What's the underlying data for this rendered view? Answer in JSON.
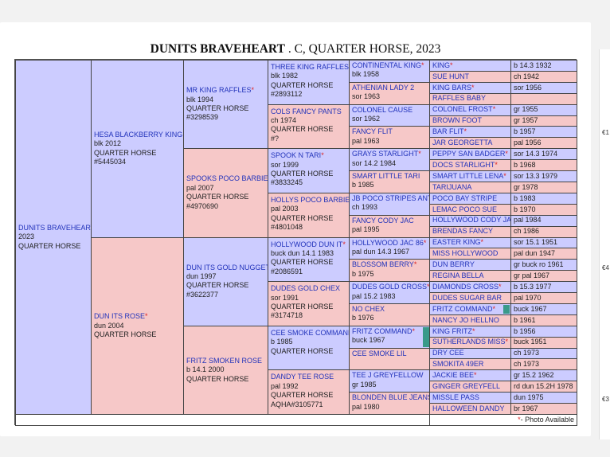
{
  "title": {
    "name": "DUNITS BRAVEHEART",
    "rest": " . C, QUARTER HORSE, 2023"
  },
  "colors": {
    "male": "#ccccff",
    "female": "#f6c8c8",
    "star": "#dd2222",
    "name": "#2233bb"
  },
  "subject": {
    "name": "DUNITS BRAVEHEART",
    "l1": "2023",
    "l2": "QUARTER HORSE"
  },
  "gen1": {
    "sire": {
      "name": "HESA BLACKBERRY KING",
      "l1": "blk 2012",
      "l2": "QUARTER HORSE",
      "l3": "#5445034"
    },
    "dam": {
      "name": "DUN ITS ROSE",
      "l1": "dun 2004",
      "l2": "QUARTER HORSE"
    }
  },
  "gen2": [
    {
      "name": "MR KING RAFFLES",
      "l1": "blk 1994",
      "l2": "QUARTER HORSE",
      "l3": "#3298539"
    },
    {
      "name": "SPOOKS POCO BARBIE",
      "l1": "pal 2007",
      "l2": "QUARTER HORSE",
      "l3": "#4970690"
    },
    {
      "name": "DUN ITS GOLD NUGGET",
      "l1": "dun 1997",
      "l2": "QUARTER HORSE",
      "l3": "#3622377"
    },
    {
      "name": "FRITZ SMOKEN ROSE",
      "l1": "b 14.1 2000",
      "l2": "QUARTER HORSE"
    }
  ],
  "gen3": [
    {
      "name": "THREE KING RAFFLES",
      "l1": "blk 1982",
      "l2": "QUARTER HORSE",
      "l3": "#2893112"
    },
    {
      "name": "COLS FANCY PANTS",
      "l1": "ch 1974",
      "l2": "QUARTER HORSE",
      "l3": "#?"
    },
    {
      "name": "SPOOK N TARI",
      "l1": "sor 1999",
      "l2": "QUARTER HORSE",
      "l3": "#3833245"
    },
    {
      "name": "HOLLYS POCO BARBIE",
      "l1": "pal 2003",
      "l2": "QUARTER HORSE",
      "l3": "#4801048"
    },
    {
      "name": "HOLLYWOOD DUN IT",
      "l1": "buck dun 14.1 1983",
      "l2": "QUARTER HORSE",
      "l3": "#2086591"
    },
    {
      "name": "DUDES GOLD CHEX",
      "l1": "sor 1991",
      "l2": "QUARTER HORSE",
      "l3": "#3174718"
    },
    {
      "name": "CEE SMOKE COMMAND",
      "l1": "b 1985",
      "l2": "QUARTER HORSE"
    },
    {
      "name": "DANDY TEE ROSE",
      "l1": "pal 1992",
      "l2": "QUARTER HORSE",
      "l3": "AQHA#3105771"
    }
  ],
  "gen4": [
    {
      "name": "CONTINENTAL KING",
      "l1": "blk 1958"
    },
    {
      "name": "ATHENIAN LADY 2",
      "l1": "sor 1963"
    },
    {
      "name": "COLONEL CAUSE",
      "l1": "sor 1962"
    },
    {
      "name": "FANCY FLIT",
      "l1": "pal 1963"
    },
    {
      "name": "GRAYS STARLIGHT",
      "l1": "sor 14.2 1984"
    },
    {
      "name": "SMART LITTLE TARI",
      "l1": "b 1985"
    },
    {
      "name": "JB POCO STRIPES ANT",
      "l1": "ch 1993"
    },
    {
      "name": "FANCY CODY JAC",
      "l1": "pal 1995"
    },
    {
      "name": "HOLLYWOOD JAC 86",
      "l1": "pal dun 14.3 1967"
    },
    {
      "name": "BLOSSOM BERRY",
      "l1": "b 1975"
    },
    {
      "name": "DUDES GOLD CROSS",
      "l1": "pal 15.2 1983"
    },
    {
      "name": "NO CHEX",
      "l1": "b 1976"
    },
    {
      "name": "FRITZ COMMAND",
      "l1": "buck 1967"
    },
    {
      "name": "CEE SMOKE LIL",
      "l1": ""
    },
    {
      "name": "TEE J GREYFELLOW",
      "l1": "gr 1985"
    },
    {
      "name": "BLONDEN BLUE JEANS",
      "l1": "pal 1980"
    }
  ],
  "gen5": [
    {
      "name": "KING",
      "info": "b 14.3 1932"
    },
    {
      "name": "SUE HUNT",
      "info": "ch 1942"
    },
    {
      "name": "KING BARS",
      "info": "sor 1956"
    },
    {
      "name": "RAFFLES BABY",
      "info": ""
    },
    {
      "name": "COLONEL FROST",
      "info": "gr 1955"
    },
    {
      "name": "BROWN FOOT",
      "info": "gr 1957"
    },
    {
      "name": "BAR FLIT",
      "info": "b 1957"
    },
    {
      "name": "JAR GEORGETTA",
      "info": "pal 1956"
    },
    {
      "name": "PEPPY SAN BADGER",
      "info": "sor 14.3 1974"
    },
    {
      "name": "DOCS STARLIGHT",
      "info": "b 1968"
    },
    {
      "name": "SMART LITTLE LENA",
      "info": "sor 13.3 1979"
    },
    {
      "name": "TARIJUANA",
      "info": "gr 1978"
    },
    {
      "name": "POCO BAY STRIPE",
      "info": "b 1983"
    },
    {
      "name": "LEMAC POCO SUE",
      "info": "b 1970"
    },
    {
      "name": "HOLLYWOOD CODY JAC",
      "info": "pal 1984"
    },
    {
      "name": "BRENDAS FANCY",
      "info": "ch 1986"
    },
    {
      "name": "EASTER KING",
      "info": "sor 15.1 1951"
    },
    {
      "name": "MISS HOLLYWOOD",
      "info": "pal dun 1947"
    },
    {
      "name": "DUN BERRY",
      "info": "gr buck ro 1961"
    },
    {
      "name": "REGINA BELLA",
      "info": "gr pal 1967"
    },
    {
      "name": "DIAMONDS CROSS",
      "info": "b 15.3 1977"
    },
    {
      "name": "DUDES SUGAR BAR",
      "info": "pal 1970"
    },
    {
      "name": "FRITZ COMMAND",
      "info": "buck 1967"
    },
    {
      "name": "NANCY JO HELLNO",
      "info": "b 1961"
    },
    {
      "name": "KING FRITZ",
      "info": "b 1956"
    },
    {
      "name": "SUTHERLANDS MISS",
      "info": "buck 1951"
    },
    {
      "name": "DRY CEE",
      "info": "ch 1973"
    },
    {
      "name": "SMOKITA 49ER",
      "info": "ch 1973"
    },
    {
      "name": "JACKIE BEE",
      "info": "gr 15.2 1962"
    },
    {
      "name": "GINGER GREYFELL",
      "info": "rd dun 15.2H 1978"
    },
    {
      "name": "MISSLE PASS",
      "info": "dun 1975"
    },
    {
      "name": "HALLOWEEN DANDY",
      "info": "br 1967"
    }
  ],
  "legend": {
    "star": "*",
    "text": " - Photo Available"
  },
  "side_prices": [
    "€1",
    "€4",
    "€3"
  ]
}
